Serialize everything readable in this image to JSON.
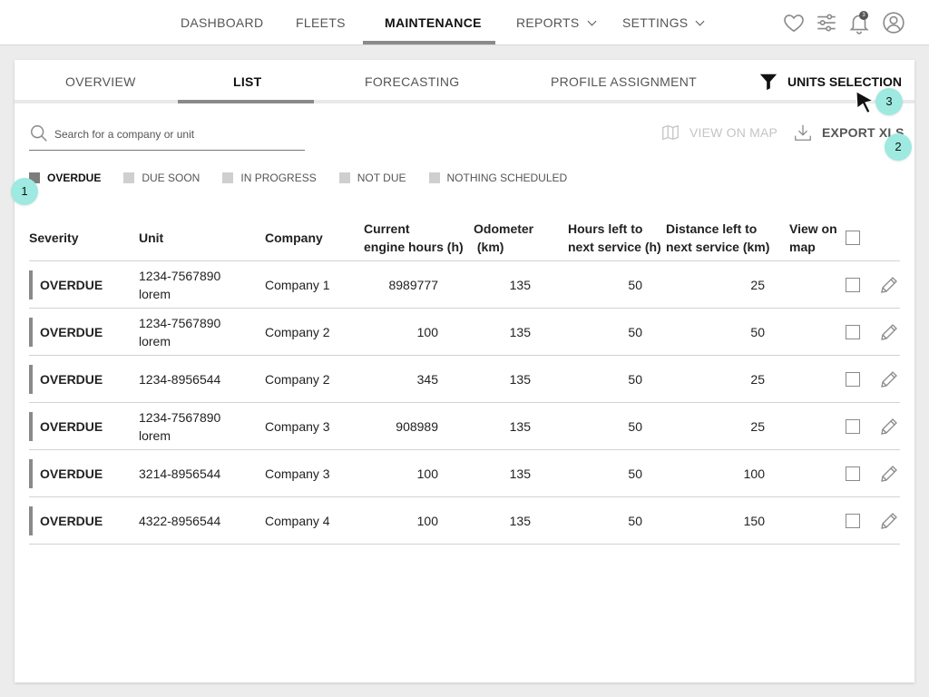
{
  "topnav": {
    "items": [
      {
        "label": "DASHBOARD"
      },
      {
        "label": "FLEETS"
      },
      {
        "label": "MAINTENANCE"
      },
      {
        "label": "REPORTS"
      },
      {
        "label": "SETTINGS"
      }
    ],
    "notification_count": "3",
    "icons": [
      "heart-icon",
      "sliders-icon",
      "bell-icon",
      "user-icon"
    ]
  },
  "tabs": {
    "items": [
      {
        "label": "OVERVIEW"
      },
      {
        "label": "LIST"
      },
      {
        "label": "FORECASTING"
      },
      {
        "label": "PROFILE ASSIGNMENT"
      }
    ],
    "units_selection": "UNITS SELECTION"
  },
  "toolbar": {
    "search_placeholder": "Search for a company or unit",
    "view_on_map": "VIEW ON MAP",
    "export_xls": "EXPORT XLS"
  },
  "legend": {
    "items": [
      {
        "label": "OVERDUE"
      },
      {
        "label": "DUE SOON"
      },
      {
        "label": "IN PROGRESS"
      },
      {
        "label": "NOT DUE"
      },
      {
        "label": "NOTHING SCHEDULED"
      }
    ]
  },
  "table": {
    "headers": {
      "severity": [
        "Severity"
      ],
      "unit": [
        "Unit"
      ],
      "company": [
        "Company"
      ],
      "engine_hours": [
        "Current",
        "engine hours (h)"
      ],
      "odometer": [
        "Odometer",
        " (km)"
      ],
      "hours_left": [
        "Hours left to",
        "next service (h)"
      ],
      "distance_left": [
        "Distance left to",
        "next service (km)"
      ],
      "view_on_map": [
        "View on",
        "map"
      ]
    },
    "rows": [
      {
        "severity": "OVERDUE",
        "unit": [
          "1234-7567890",
          "lorem"
        ],
        "company": "Company 1",
        "engine_hours": "8989777",
        "odometer": "135",
        "hours_left": "50",
        "distance_left": "25"
      },
      {
        "severity": "OVERDUE",
        "unit": [
          "1234-7567890",
          "lorem"
        ],
        "company": "Company 2",
        "engine_hours": "100",
        "odometer": "135",
        "hours_left": "50",
        "distance_left": "50"
      },
      {
        "severity": "OVERDUE",
        "unit": [
          "1234-8956544"
        ],
        "company": "Company 2",
        "engine_hours": "345",
        "odometer": "135",
        "hours_left": "50",
        "distance_left": "25"
      },
      {
        "severity": "OVERDUE",
        "unit": [
          "1234-7567890",
          "lorem"
        ],
        "company": "Company 3",
        "engine_hours": "908989",
        "odometer": "135",
        "hours_left": "50",
        "distance_left": "25"
      },
      {
        "severity": "OVERDUE",
        "unit": [
          "3214-8956544"
        ],
        "company": "Company 3",
        "engine_hours": "100",
        "odometer": "135",
        "hours_left": "50",
        "distance_left": "100"
      },
      {
        "severity": "OVERDUE",
        "unit": [
          "4322-8956544"
        ],
        "company": "Company 4",
        "engine_hours": "100",
        "odometer": "135",
        "hours_left": "50",
        "distance_left": "150"
      }
    ]
  },
  "annotations": {
    "markers": [
      "1",
      "2",
      "3"
    ]
  },
  "colors": {
    "marker": "#9ee9e0",
    "active_underline": "#8a8a8a",
    "severity_bar": "#8a8a8a"
  }
}
